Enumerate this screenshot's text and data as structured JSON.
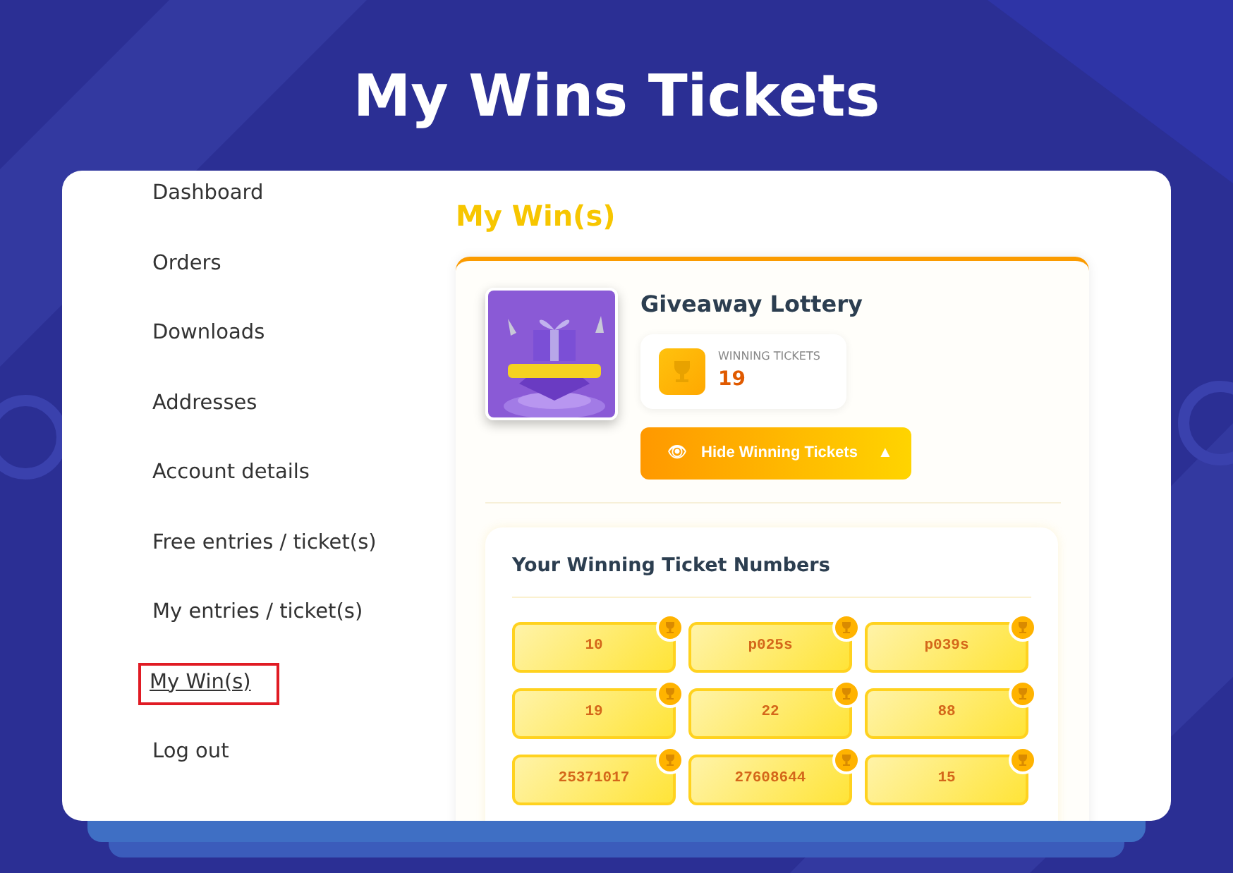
{
  "page_title": "My Wins Tickets",
  "sidebar": {
    "items": [
      {
        "label": "Dashboard",
        "selected": false
      },
      {
        "label": "Orders",
        "selected": false
      },
      {
        "label": "Downloads",
        "selected": false
      },
      {
        "label": "Addresses",
        "selected": false
      },
      {
        "label": "Account details",
        "selected": false
      },
      {
        "label": "Free entries / ticket(s)",
        "selected": false
      },
      {
        "label": "My entries / ticket(s)",
        "selected": false
      },
      {
        "label": "My Win(s)",
        "selected": true
      },
      {
        "label": "Log out",
        "selected": false
      }
    ]
  },
  "main": {
    "heading": "My Win(s)",
    "lottery": {
      "name": "Giveaway Lottery",
      "stat": {
        "label": "WINNING TICKETS",
        "value": "19"
      },
      "toggle_button": {
        "icon": "👁",
        "label": "Hide Winning Tickets",
        "caret": "▲",
        "expanded": true
      },
      "tickets_panel": {
        "heading": "Your Winning Ticket Numbers",
        "tickets": [
          "10",
          "p025s",
          "p039s",
          "19",
          "22",
          "88",
          "25371017",
          "27608644",
          "15"
        ]
      }
    }
  }
}
